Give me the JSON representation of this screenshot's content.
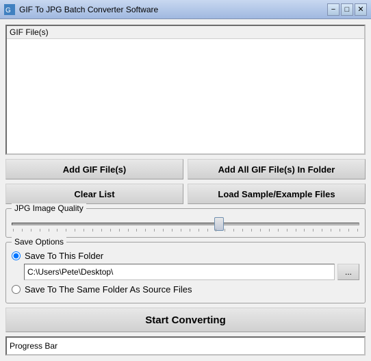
{
  "titleBar": {
    "title": "GIF To JPG Batch Converter Software",
    "minBtn": "−",
    "maxBtn": "□",
    "closeBtn": "✕"
  },
  "fileList": {
    "label": "GIF File(s)"
  },
  "buttons": {
    "addGif": "Add GIF File(s)",
    "addAllGif": "Add All GIF File(s) In Folder",
    "clearList": "Clear List",
    "loadSample": "Load Sample/Example Files"
  },
  "jpgQuality": {
    "label": "JPG Image Quality",
    "sliderValue": 60
  },
  "saveOptions": {
    "label": "Save Options",
    "option1": "Save To This Folder",
    "option2": "Save To The Same Folder As Source Files",
    "path": "C:\\Users\\Pete\\Desktop\\",
    "browseBtnLabel": "..."
  },
  "startBtn": "Start Converting",
  "progressBar": {
    "label": "Progress Bar"
  }
}
